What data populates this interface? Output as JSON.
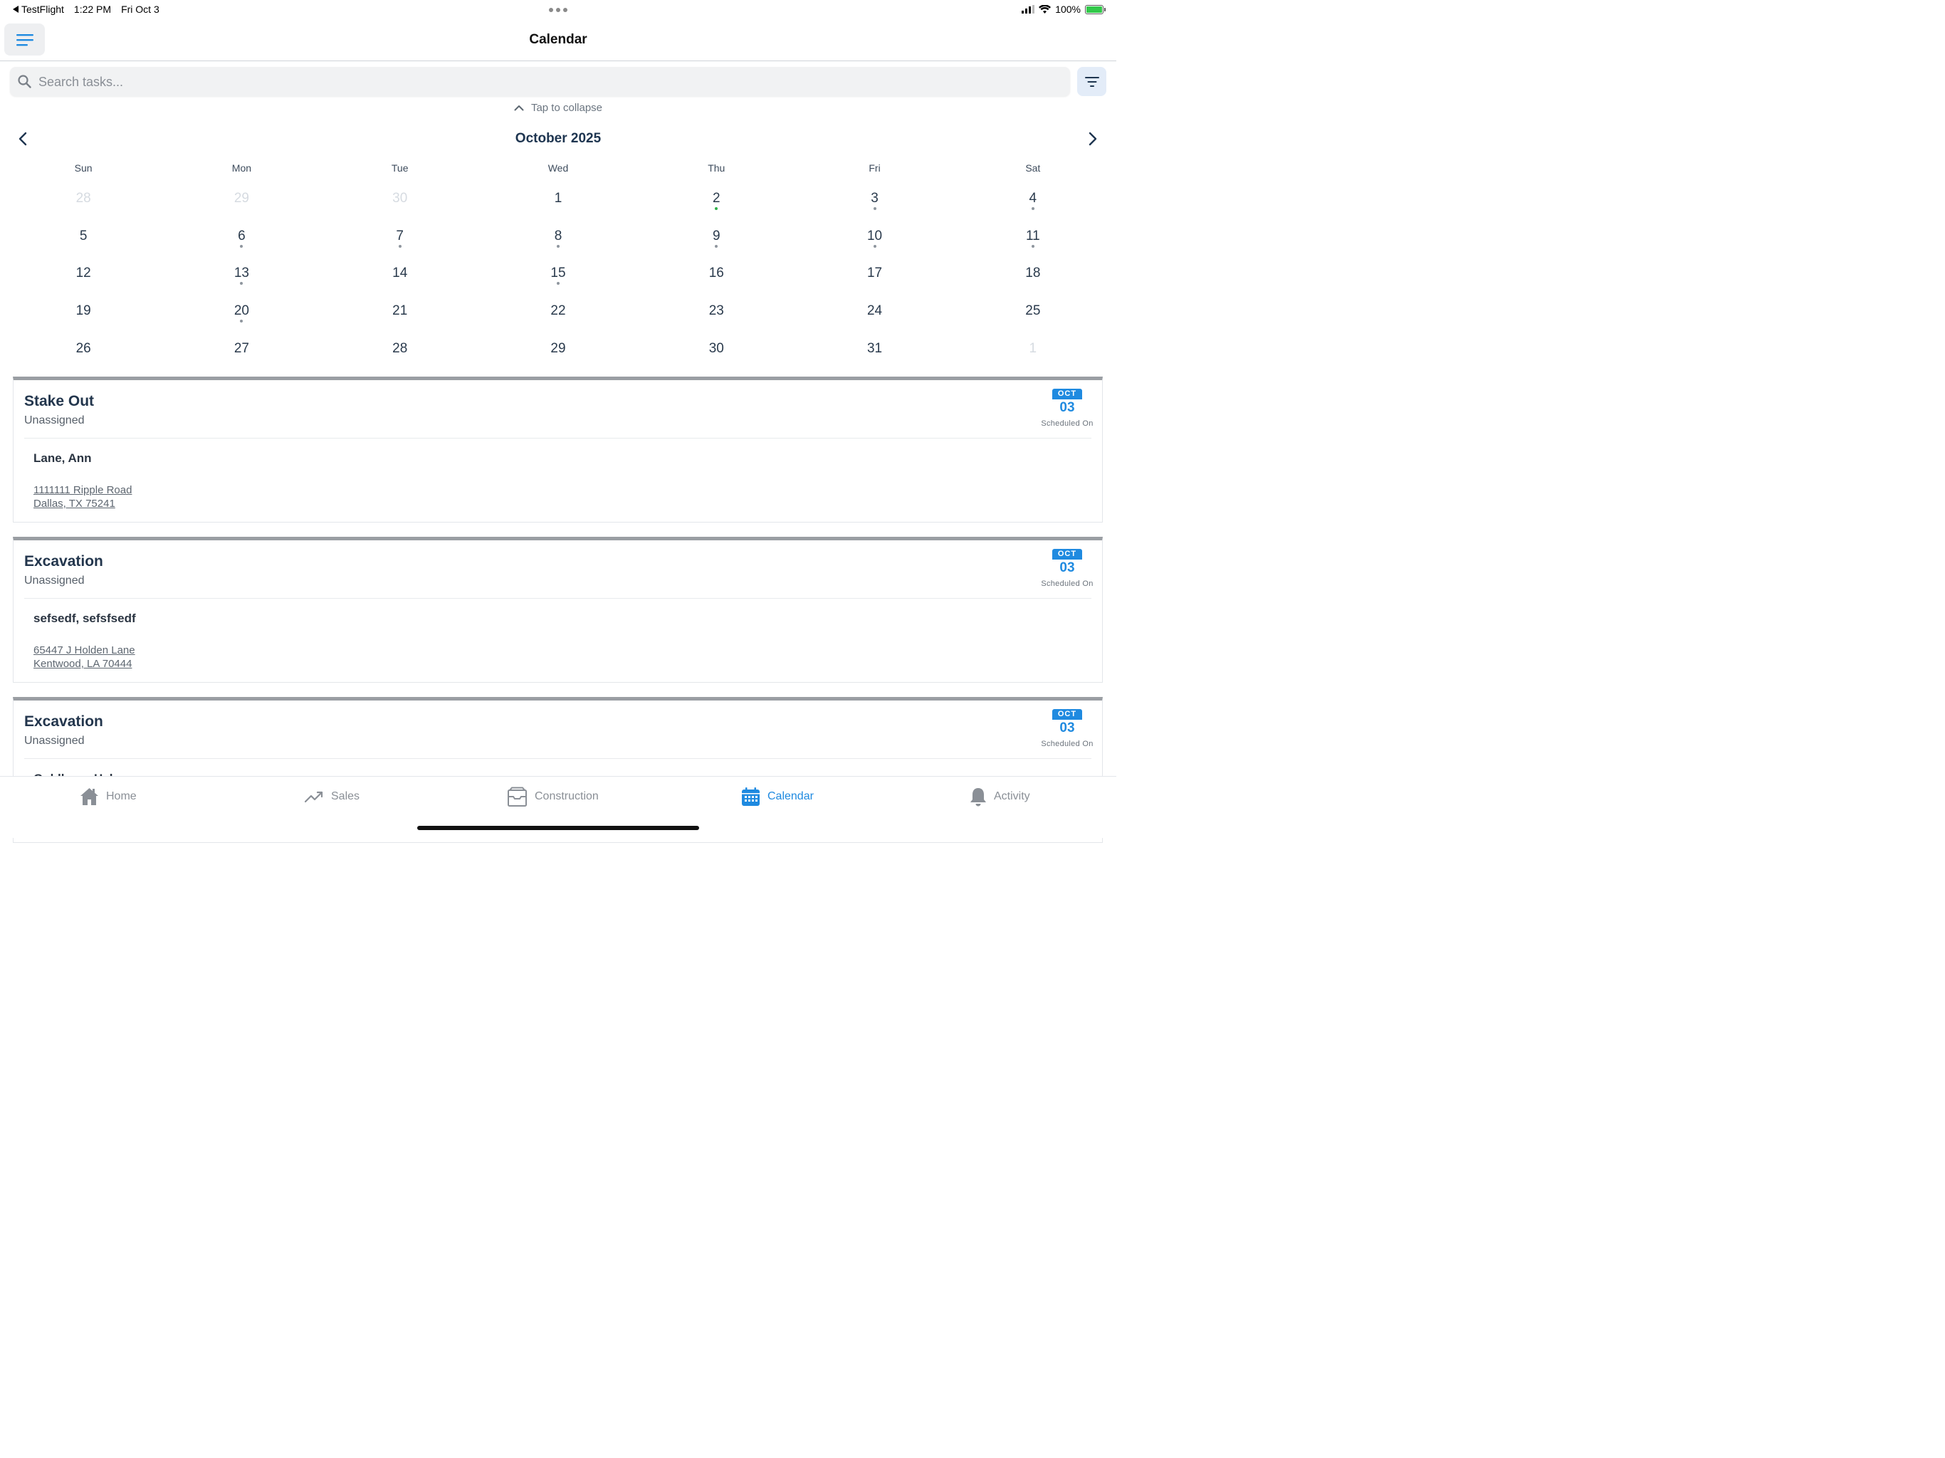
{
  "status_bar": {
    "back_app": "TestFlight",
    "time": "1:22 PM",
    "date": "Fri Oct 3",
    "battery": "100%"
  },
  "nav": {
    "title": "Calendar"
  },
  "search": {
    "placeholder": "Search tasks..."
  },
  "calendar": {
    "collapse_label": "Tap to collapse",
    "month_label": "October 2025",
    "weekdays": [
      "Sun",
      "Mon",
      "Tue",
      "Wed",
      "Thu",
      "Fri",
      "Sat"
    ],
    "weeks": [
      [
        {
          "d": "28",
          "muted": true
        },
        {
          "d": "29",
          "muted": true
        },
        {
          "d": "30",
          "muted": true
        },
        {
          "d": "1"
        },
        {
          "d": "2",
          "dot": "green"
        },
        {
          "d": "3",
          "dot": "gray"
        },
        {
          "d": "4",
          "dot": "gray"
        }
      ],
      [
        {
          "d": "5"
        },
        {
          "d": "6",
          "dot": "gray"
        },
        {
          "d": "7",
          "dot": "gray"
        },
        {
          "d": "8",
          "dot": "gray"
        },
        {
          "d": "9",
          "dot": "gray"
        },
        {
          "d": "10",
          "dot": "gray"
        },
        {
          "d": "11",
          "dot": "gray"
        }
      ],
      [
        {
          "d": "12"
        },
        {
          "d": "13",
          "dot": "gray"
        },
        {
          "d": "14"
        },
        {
          "d": "15",
          "dot": "gray"
        },
        {
          "d": "16"
        },
        {
          "d": "17"
        },
        {
          "d": "18"
        }
      ],
      [
        {
          "d": "19"
        },
        {
          "d": "20",
          "dot": "gray"
        },
        {
          "d": "21"
        },
        {
          "d": "22"
        },
        {
          "d": "23"
        },
        {
          "d": "24"
        },
        {
          "d": "25"
        }
      ],
      [
        {
          "d": "26"
        },
        {
          "d": "27"
        },
        {
          "d": "28"
        },
        {
          "d": "29"
        },
        {
          "d": "30"
        },
        {
          "d": "31"
        },
        {
          "d": "1",
          "muted": true
        }
      ]
    ]
  },
  "tasks": [
    {
      "title": "Stake Out",
      "assignee": "Unassigned",
      "client": "Lane, Ann",
      "address_line1": "1111111 Ripple Road",
      "address_line2": "Dallas, TX 75241",
      "month": "OCT",
      "day": "03",
      "date_label": "Scheduled On"
    },
    {
      "title": "Excavation",
      "assignee": "Unassigned",
      "client": "sefsedf, sefsfsedf",
      "address_line1": "65447 J Holden Lane",
      "address_line2": "Kentwood, LA 70444",
      "month": "OCT",
      "day": "03",
      "date_label": "Scheduled On"
    },
    {
      "title": "Excavation",
      "assignee": "Unassigned",
      "client": "Goldberg, Hal",
      "address_line1": "",
      "address_line2": "",
      "month": "OCT",
      "day": "03",
      "date_label": "Scheduled On"
    }
  ],
  "tabbar": {
    "items": [
      {
        "label": "Home",
        "icon": "home-icon"
      },
      {
        "label": "Sales",
        "icon": "trend-up-icon"
      },
      {
        "label": "Construction",
        "icon": "inbox-box-icon"
      },
      {
        "label": "Calendar",
        "icon": "calendar-icon",
        "active": true
      },
      {
        "label": "Activity",
        "icon": "bell-icon"
      }
    ]
  },
  "colors": {
    "accent": "#1f8ae0",
    "title": "#1e3550",
    "event_dot": "#8f969e",
    "today_dot": "#2fb14a"
  }
}
